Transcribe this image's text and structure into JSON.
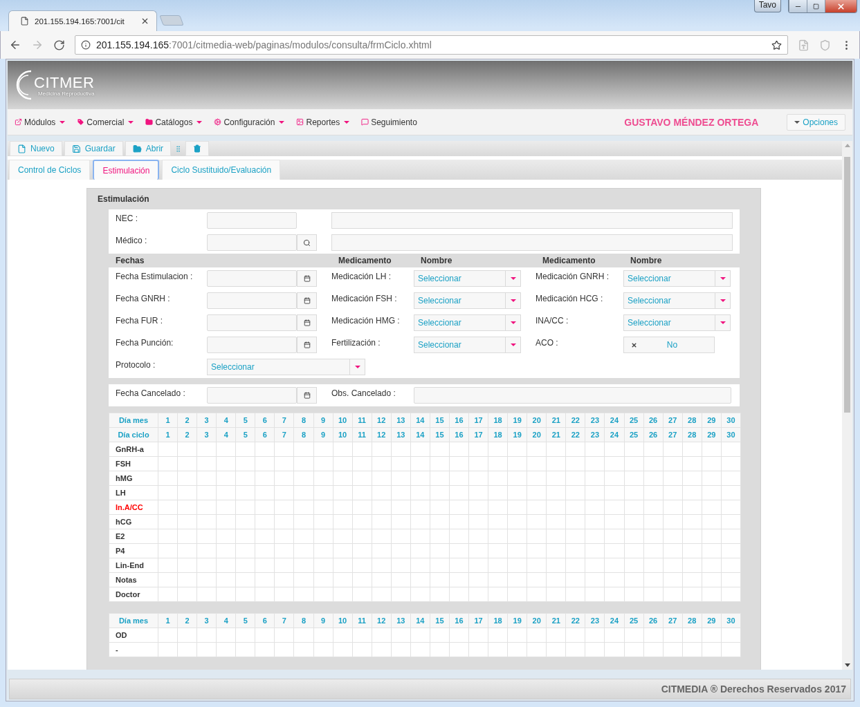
{
  "browser": {
    "tab_title": "201.155.194.165:7001/cit",
    "url_host": "201.155.194.165",
    "url_path": ":7001/citmedia-web/paginas/modulos/consulta/frmCiclo.xhtml",
    "user_badge": "Tavo"
  },
  "header": {
    "logo_text": "CITMER",
    "logo_tagline": "Medicina Reproductiva"
  },
  "menu": [
    {
      "label": "Módulos",
      "kind": "modules",
      "dropdown": true
    },
    {
      "label": "Comercial",
      "kind": "tag",
      "dropdown": true
    },
    {
      "label": "Catálogos",
      "kind": "folder",
      "dropdown": true
    },
    {
      "label": "Configuración",
      "kind": "gear",
      "dropdown": true
    },
    {
      "label": "Reportes",
      "kind": "image",
      "dropdown": true
    },
    {
      "label": "Seguimiento",
      "kind": "chat",
      "dropdown": false
    }
  ],
  "user_name": "GUSTAVO MÉNDEZ ORTEGA",
  "options_button": "Opciones",
  "toolbar": [
    {
      "label": "Nuevo",
      "kind": "new"
    },
    {
      "label": "Guardar",
      "kind": "save"
    },
    {
      "label": "Abrir",
      "kind": "open"
    }
  ],
  "tabs": [
    {
      "label": "Control de Ciclos",
      "selected": false
    },
    {
      "label": "Estimulación",
      "selected": true
    },
    {
      "label": "Ciclo Sustituido/Evaluación",
      "selected": false
    }
  ],
  "panel": {
    "title": "Estimulación",
    "patient_fields": [
      {
        "label": "NEC :",
        "kind": "text"
      },
      {
        "label": "Médico :",
        "kind": "search"
      }
    ],
    "section_headers": [
      "Fechas",
      "Medicamento",
      "Nombre",
      "Medicamento",
      "Nombre"
    ],
    "rows": [
      {
        "date_label": "Fecha Estimulacion :",
        "med_label": "Medicación LH :",
        "med_value": "Seleccionar",
        "extra": {
          "kind": "select",
          "label": "Medicación GNRH :",
          "value": "Seleccionar"
        }
      },
      {
        "date_label": "Fecha GNRH :",
        "med_label": "Medicación FSH :",
        "med_value": "Seleccionar",
        "extra": {
          "kind": "select",
          "label": "Medicación HCG :",
          "value": "Seleccionar"
        }
      },
      {
        "date_label": "Fecha FUR :",
        "med_label": "Medicación HMG :",
        "med_value": "Seleccionar",
        "extra": {
          "kind": "select",
          "label": "INA/CC :",
          "value": "Seleccionar"
        }
      },
      {
        "date_label": "Fecha Punción:",
        "med_label": "Fertilización :",
        "med_value": "Seleccionar",
        "extra": {
          "kind": "toggle",
          "label": "ACO :",
          "value": "No",
          "on": false
        }
      }
    ],
    "protocol": {
      "label": "Protocolo :",
      "value": "Seleccionar"
    },
    "cancel": {
      "date_label": "Fecha Cancelado :",
      "obs_label": "Obs. Cancelado :"
    },
    "schedule": {
      "header_rows": [
        {
          "label": "Día mes",
          "days": [
            "1",
            "2",
            "3",
            "4",
            "5",
            "6",
            "7",
            "8",
            "9",
            "10",
            "11",
            "12",
            "13",
            "14",
            "15",
            "16",
            "17",
            "18",
            "19",
            "20",
            "21",
            "22",
            "23",
            "24",
            "25",
            "26",
            "27",
            "28",
            "29",
            "30"
          ]
        },
        {
          "label": "Día ciclo",
          "days": [
            "1",
            "2",
            "3",
            "4",
            "5",
            "6",
            "7",
            "8",
            "9",
            "10",
            "11",
            "12",
            "13",
            "14",
            "15",
            "16",
            "17",
            "18",
            "19",
            "20",
            "21",
            "22",
            "23",
            "24",
            "25",
            "26",
            "27",
            "28",
            "29",
            "30"
          ]
        }
      ],
      "rows": [
        {
          "label": "GnRH-a",
          "alert": false
        },
        {
          "label": "FSH",
          "alert": false
        },
        {
          "label": "hMG",
          "alert": false
        },
        {
          "label": "LH",
          "alert": false
        },
        {
          "label": "In.A/CC",
          "alert": true
        },
        {
          "label": "hCG",
          "alert": false
        },
        {
          "label": "E2",
          "alert": false
        },
        {
          "label": "P4",
          "alert": false
        },
        {
          "label": "Lin-End",
          "alert": false
        },
        {
          "label": "Notas",
          "alert": false
        },
        {
          "label": "Doctor",
          "alert": false
        }
      ]
    },
    "ovary_table": {
      "header_rows": [
        {
          "label": "Día mes",
          "days": [
            "1",
            "2",
            "3",
            "4",
            "5",
            "6",
            "7",
            "8",
            "9",
            "10",
            "11",
            "12",
            "13",
            "14",
            "15",
            "16",
            "17",
            "18",
            "19",
            "20",
            "21",
            "22",
            "23",
            "24",
            "25",
            "26",
            "27",
            "28",
            "29",
            "30"
          ]
        }
      ],
      "rows": [
        {
          "label": "OD",
          "alert": false
        },
        {
          "label": "-",
          "alert": false
        }
      ]
    }
  },
  "footer": "CITMEDIA ® Derechos Reservados 2017"
}
